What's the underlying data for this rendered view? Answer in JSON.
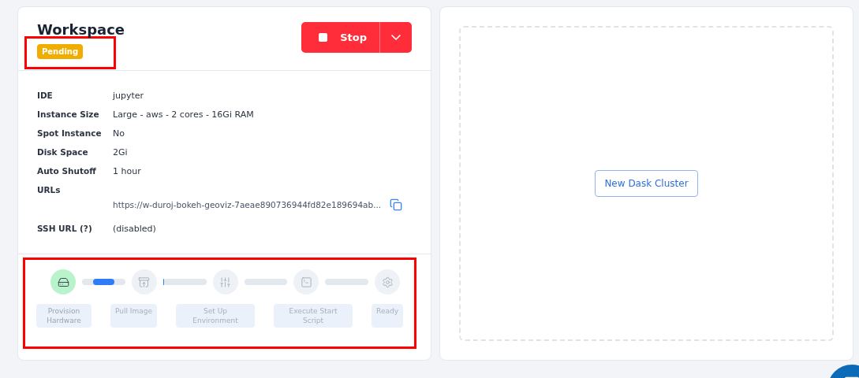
{
  "workspace": {
    "title": "Workspace",
    "status": "Pending",
    "stop_button": "Stop"
  },
  "details": [
    {
      "label": "IDE",
      "value": "jupyter",
      "kind": "text"
    },
    {
      "label": "Instance Size",
      "value": "Large - aws - 2 cores - 16Gi RAM",
      "kind": "text"
    },
    {
      "label": "Spot Instance",
      "value": "No",
      "kind": "text"
    },
    {
      "label": "Disk Space",
      "value": "2Gi",
      "kind": "text"
    },
    {
      "label": "Auto Shutoff",
      "value": "1 hour",
      "kind": "text"
    },
    {
      "label": "URLs",
      "value": "https://w-duroj-bokeh-geoviz-7aeae890736944fd82e189694ab...",
      "kind": "url"
    },
    {
      "label": "SSH URL (?)",
      "value": "(disabled)",
      "kind": "text"
    }
  ],
  "steps": [
    {
      "label": "Provision Hardware",
      "done": true
    },
    {
      "label": "Pull Image",
      "done": false
    },
    {
      "label": "Set Up Environment",
      "done": false
    },
    {
      "label": "Execute Start Script",
      "done": false
    },
    {
      "label": "Ready",
      "done": false
    }
  ],
  "connectors": [
    {
      "level": 0.5
    },
    {
      "level": 0.03
    }
  ],
  "dask": {
    "button": "New Dask Cluster"
  }
}
